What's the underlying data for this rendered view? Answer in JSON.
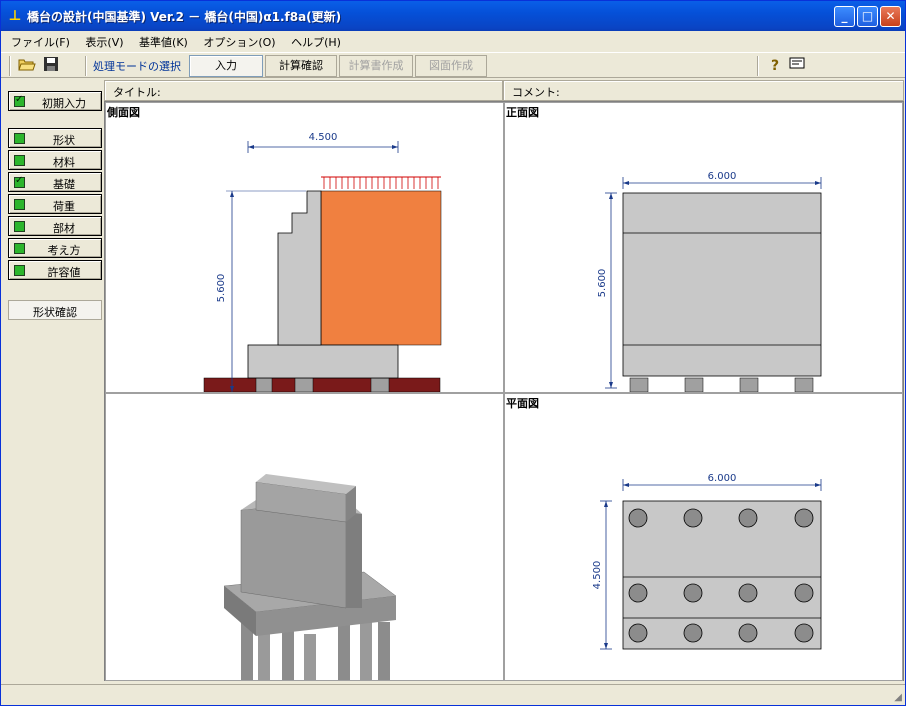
{
  "window": {
    "title": "橋台の設計(中国基準) Ver.2 － 橋台(中国)α1.f8a(更新)",
    "app_icon": "bridge-abutment-icon",
    "controls": [
      "minimize",
      "maximize",
      "close"
    ]
  },
  "menu": [
    "ファイル(F)",
    "表示(V)",
    "基準値(K)",
    "オプション(O)",
    "ヘルプ(H)"
  ],
  "toolbar": {
    "open_icon": "folder-open-icon",
    "save_icon": "floppy-disk-icon",
    "mode_label": "処理モードの選択",
    "modes": [
      {
        "label": "入力",
        "state": "active"
      },
      {
        "label": "計算確認",
        "state": "enabled"
      },
      {
        "label": "計算書作成",
        "state": "disabled"
      },
      {
        "label": "図面作成",
        "state": "disabled"
      }
    ],
    "help_icon": "help-question-icon",
    "info_icon": "info-card-icon"
  },
  "sidebar": {
    "initial": {
      "label": "初期入力",
      "checked": true
    },
    "items": [
      {
        "label": "形状",
        "checked": false
      },
      {
        "label": "材料",
        "checked": false
      },
      {
        "label": "基礎",
        "checked": true
      },
      {
        "label": "荷重",
        "checked": false
      },
      {
        "label": "部材",
        "checked": false
      },
      {
        "label": "考え方",
        "checked": false
      },
      {
        "label": "許容値",
        "checked": false
      }
    ],
    "shape_confirm": "形状確認"
  },
  "panel": {
    "title_label": "タイトル:",
    "comment_label": "コメント:"
  },
  "views": {
    "side": {
      "label": "側面図",
      "width_dim": "4.500",
      "height_dim": "5.600"
    },
    "front": {
      "label": "正面図",
      "width_dim": "6.000",
      "height_dim": "5.600"
    },
    "plan": {
      "label": "平面図",
      "width_dim": "6.000",
      "height_dim": "4.500"
    },
    "iso": {
      "label": ""
    }
  },
  "colors": {
    "concrete": "#c8c8c8",
    "soil": "#f08040",
    "footing_base": "#7a1a1a",
    "dimension": "#1a3a8a",
    "load_arrows": "#d00000"
  }
}
